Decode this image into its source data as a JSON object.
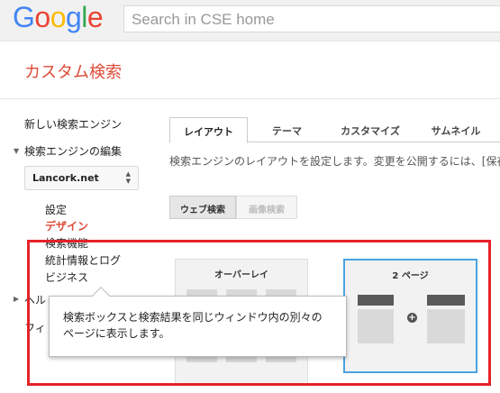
{
  "header": {
    "logo_letters": [
      "G",
      "o",
      "o",
      "g",
      "l",
      "e"
    ],
    "logo_colors": [
      "#4285f4",
      "#ea4335",
      "#fbbc05",
      "#4285f4",
      "#34a853",
      "#ea4335"
    ],
    "search_placeholder": "Search in CSE home"
  },
  "page": {
    "title": "カスタム検索"
  },
  "sidebar": {
    "new_engine": "新しい検索エンジン",
    "edit_engines": "検索エンジンの編集",
    "engine_select": "Lancork.net",
    "subitems": [
      "設定",
      "デザイン",
      "検索機能",
      "統計情報とログ",
      "ビジネス"
    ],
    "active_subitem": "デザイン",
    "help": "ヘル",
    "feedback": "フィ"
  },
  "tabs": [
    "レイアウト",
    "テーマ",
    "カスタマイズ",
    "サムネイル"
  ],
  "description": "検索エンジンのレイアウトを設定します。変更を公開するには、[保存",
  "search_type_buttons": {
    "web": "ウェブ検索",
    "image": "画像検索"
  },
  "layouts": {
    "overlay": "オーバーレイ",
    "two_page": "2 ページ"
  },
  "tooltip": {
    "text": "検索ボックスと検索結果を同じウィンドウ内の別々のページに表示します。"
  },
  "colors": {
    "accent_red": "#dd4b39",
    "highlight_red": "#e52228",
    "selected_blue": "#4aa3df"
  },
  "icons": {
    "expand": "triangle-down-icon",
    "collapsed": "triangle-right-icon",
    "select_arrows": "updown-arrows-icon",
    "plus": "plus-circle-icon"
  }
}
